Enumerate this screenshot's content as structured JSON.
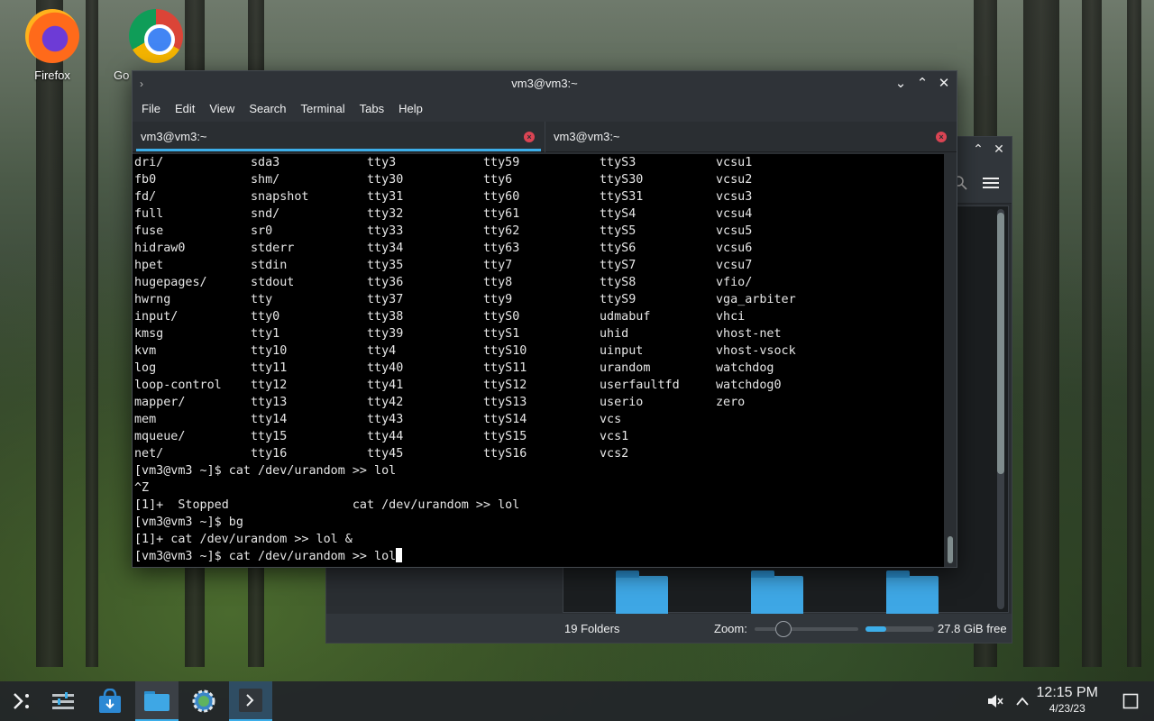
{
  "desktop": {
    "icons": [
      {
        "label": "Firefox",
        "icon": "firefox-icon"
      },
      {
        "label": "Go",
        "icon": "chrome-icon"
      }
    ]
  },
  "terminal": {
    "title": "vm3@vm3:~",
    "menu": [
      "File",
      "Edit",
      "View",
      "Search",
      "Terminal",
      "Tabs",
      "Help"
    ],
    "tabs": [
      {
        "label": "vm3@vm3:~",
        "active": true
      },
      {
        "label": "vm3@vm3:~",
        "active": false
      }
    ],
    "output": "dri/            sda3            tty3            tty59           ttyS3           vcsu1\nfb0             shm/            tty30           tty6            ttyS30          vcsu2\nfd/             snapshot        tty31           tty60           ttyS31          vcsu3\nfull            snd/            tty32           tty61           ttyS4           vcsu4\nfuse            sr0             tty33           tty62           ttyS5           vcsu5\nhidraw0         stderr          tty34           tty63           ttyS6           vcsu6\nhpet            stdin           tty35           tty7            ttyS7           vcsu7\nhugepages/      stdout          tty36           tty8            ttyS8           vfio/\nhwrng           tty             tty37           tty9            ttyS9           vga_arbiter\ninput/          tty0            tty38           ttyS0           udmabuf         vhci\nkmsg            tty1            tty39           ttyS1           uhid            vhost-net\nkvm             tty10           tty4            ttyS10          uinput          vhost-vsock\nlog             tty11           tty40           ttyS11          urandom         watchdog\nloop-control    tty12           tty41           ttyS12          userfaultfd     watchdog0\nmapper/         tty13           tty42           ttyS13          userio          zero\nmem             tty14           tty43           ttyS14          vcs\nmqueue/         tty15           tty44           ttyS15          vcs1\nnet/            tty16           tty45           ttyS16          vcs2\n[vm3@vm3 ~]$ cat /dev/urandom >> lol\n^Z\n[1]+  Stopped                 cat /dev/urandom >> lol\n[vm3@vm3 ~]$ bg\n[1]+ cat /dev/urandom >> lol &",
    "current_line": "[vm3@vm3 ~]$ cat /dev/urandom >> lol"
  },
  "file_manager": {
    "status_count": "19 Folders",
    "zoom_label": "Zoom:",
    "zoom_level": 0.2,
    "free_space": "27.8 GiB free",
    "free_fraction": 0.3
  },
  "taskbar": {
    "time": "12:15 PM",
    "date": "4/23/23",
    "items": [
      "app-launcher-icon",
      "overview-icon",
      "discover-icon",
      "dolphin-icon",
      "settings-icon",
      "konsole-icon"
    ]
  },
  "colors": {
    "accent": "#3daee9",
    "close": "#da4453"
  }
}
